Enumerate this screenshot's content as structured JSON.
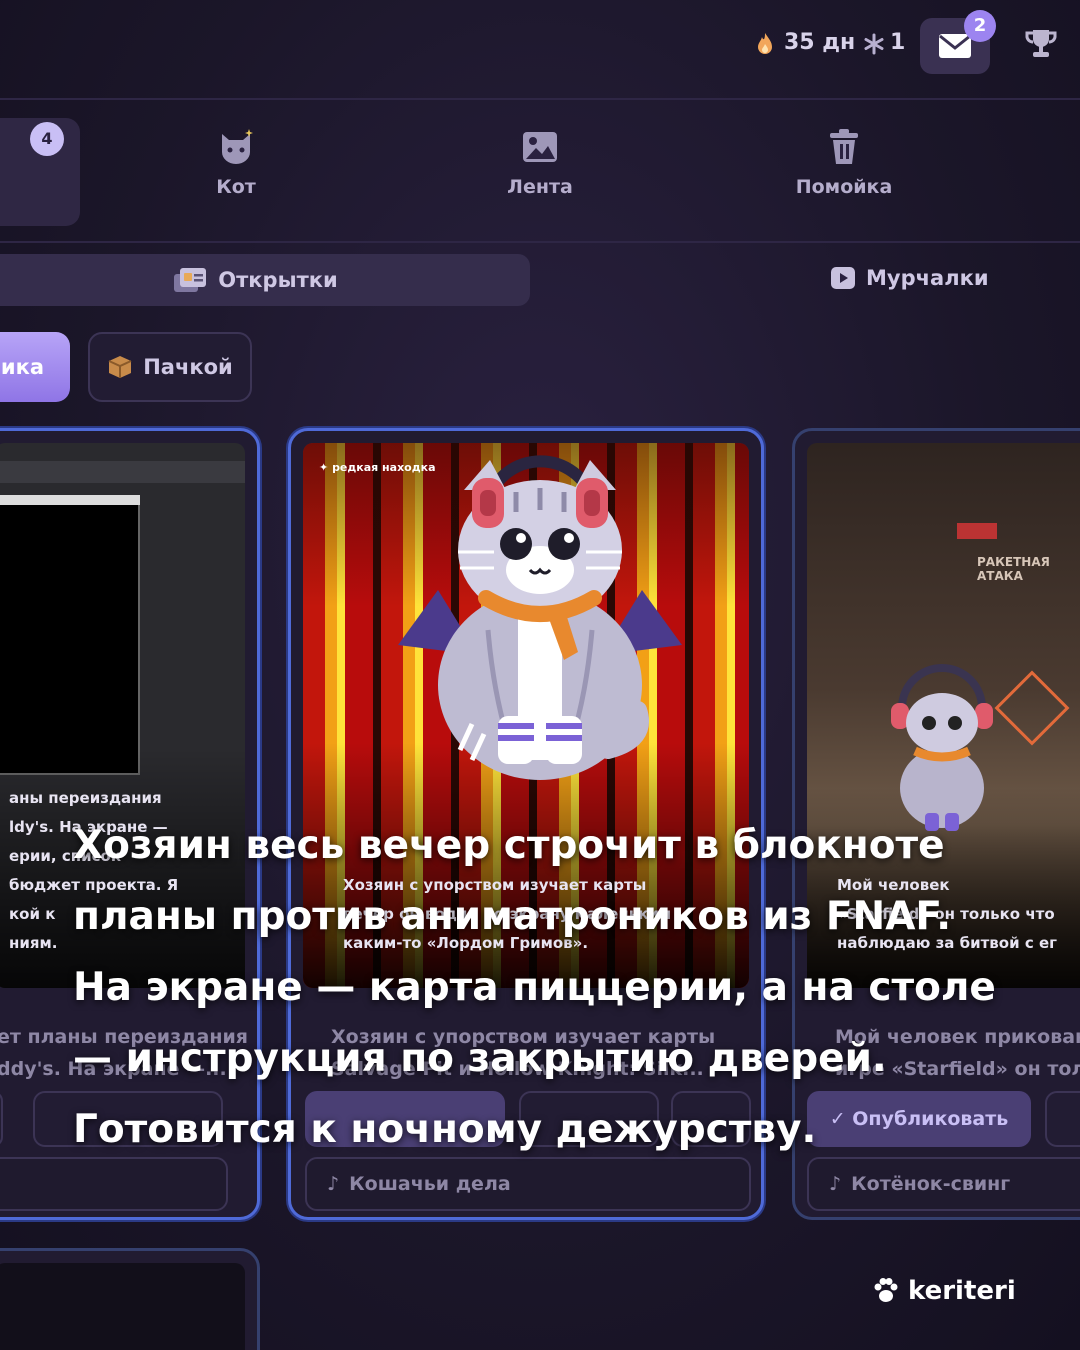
{
  "topbar": {
    "streak": "35 дн",
    "snow_count": "1",
    "mail_badge": "2"
  },
  "nav": {
    "active_badge": "4",
    "items": [
      {
        "label": "Кот",
        "icon": "cat-icon"
      },
      {
        "label": "Лента",
        "icon": "image-icon"
      },
      {
        "label": "Помойка",
        "icon": "trash-icon"
      }
    ]
  },
  "subtabs": {
    "active": "Открытки",
    "other": "Мурчалки"
  },
  "modes": {
    "active_partial": "ика",
    "other": "Пачкой"
  },
  "cards": [
    {
      "shot_lines": [
        "аны переиздания",
        "ldy's. На экране —",
        "ерии, список",
        "бюджет проекта. Я",
        "кой к",
        "ниям."
      ],
      "caption": [
        "ет планы переиздания",
        "ddy's. На экране —..."
      ],
      "track": ""
    },
    {
      "badge": "редкая находка",
      "shot_lines": [
        "Хозяин с упорством изучает карты",
        "вечер он водил по экрану маленьким",
        "каким-то «Лордом Гримов»."
      ],
      "caption": [
        "Хозяин с упорством изучает карты",
        "Salvage Pit и Hollow Knight: Silk..."
      ],
      "track": "Кошачьи дела"
    },
    {
      "shot_lines": [
        "Мой человек",
        "«Starfield» он только что",
        "наблюдаю за битвой с ег"
      ],
      "hud": "РАКЕТНАЯ АТАКА",
      "caption": [
        "Мой человек прикован к",
        "игре «Starfield» он только..."
      ],
      "publish": "Опубликовать",
      "track": "Котёнок-свинг"
    }
  ],
  "overlay_text": "Хозяин весь вечер строчит в блокноте планы против аниматроников из FNAF. На экране — карта пиццерии, а на столе — инструкция по закрытию дверей. Готовится к ночному дежурству.",
  "brand": "keriteri",
  "colors": {
    "accent": "#9c84f0",
    "card_border": "#4f6ad8",
    "background": "#1a1528"
  }
}
